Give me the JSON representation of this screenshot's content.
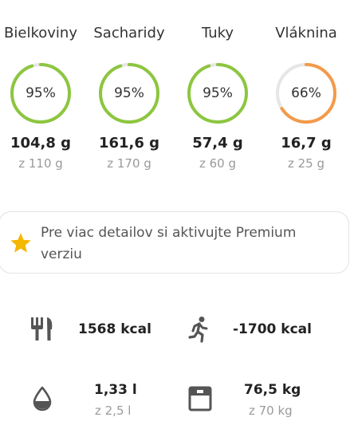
{
  "macros": [
    {
      "name": "Bielkoviny",
      "percent": "95%",
      "fraction": 0.95,
      "color": "#8cc63f",
      "value": "104,8 g",
      "goal": "z 110 g"
    },
    {
      "name": "Sacharidy",
      "percent": "95%",
      "fraction": 0.95,
      "color": "#8cc63f",
      "value": "161,6 g",
      "goal": "z 170 g"
    },
    {
      "name": "Tuky",
      "percent": "95%",
      "fraction": 0.95,
      "color": "#8cc63f",
      "value": "57,4 g",
      "goal": "z 60 g"
    },
    {
      "name": "Vláknina",
      "percent": "66%",
      "fraction": 0.66,
      "color": "#f39a4a",
      "value": "16,7 g",
      "goal": "z 25 g"
    }
  ],
  "premium": {
    "text": "Pre viac detailov si aktivujte Premium verziu",
    "star_color": "#f5b700"
  },
  "stats": {
    "food": {
      "icon": "fork-knife-icon",
      "value": "1568 kcal"
    },
    "activity": {
      "icon": "running-person-icon",
      "value": "-1700 kcal"
    },
    "water": {
      "icon": "water-drop-icon",
      "value": "1,33 l",
      "goal": "z 2,5 l"
    },
    "weight": {
      "icon": "scale-icon",
      "value": "76,5 kg",
      "goal": "z 70 kg"
    }
  },
  "colors": {
    "ring_track": "#e6e6e6",
    "icon": "#555555"
  }
}
